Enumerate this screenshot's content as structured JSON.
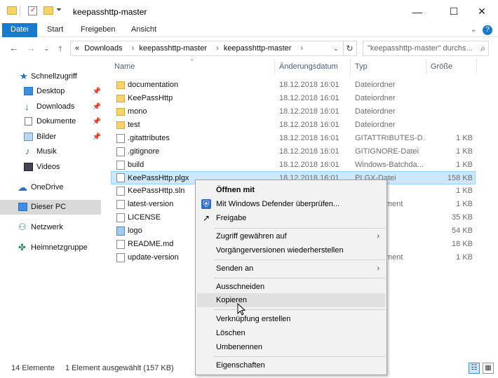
{
  "window": {
    "title": "keepasshttp-master",
    "controls": {
      "minimize": "—",
      "maximize": "☐",
      "close": "✕"
    }
  },
  "ribbon": {
    "tabs": [
      "Datei",
      "Start",
      "Freigeben",
      "Ansicht"
    ],
    "expand": "⌄",
    "help": "?"
  },
  "address": {
    "prefix": "«",
    "crumbs": [
      "Downloads",
      "keepasshttp-master",
      "keepasshttp-master"
    ],
    "separator": "›",
    "dropdown": "⌄",
    "refresh": "↻",
    "search_placeholder": "\"keepasshttp-master\" durchs...",
    "search_icon": "⌕"
  },
  "nav_buttons": {
    "back": "←",
    "forward": "→",
    "recent": "⌄",
    "up": "↑"
  },
  "navpane": {
    "items": [
      {
        "label": "Schnellzugriff",
        "icon": "star-icon",
        "glyph": "★",
        "pinned": false
      },
      {
        "label": "Desktop",
        "icon": "desktop-icon",
        "glyph": "",
        "pinned": true
      },
      {
        "label": "Downloads",
        "icon": "download-icon",
        "glyph": "↓",
        "pinned": true
      },
      {
        "label": "Dokumente",
        "icon": "documents-icon",
        "glyph": "",
        "pinned": true
      },
      {
        "label": "Bilder",
        "icon": "pictures-icon",
        "glyph": "",
        "pinned": true
      },
      {
        "label": "Musik",
        "icon": "music-icon",
        "glyph": "♪",
        "pinned": false
      },
      {
        "label": "Videos",
        "icon": "videos-icon",
        "glyph": "",
        "pinned": false
      },
      {
        "label": "OneDrive",
        "icon": "cloud-icon",
        "glyph": "☁",
        "pinned": false
      },
      {
        "label": "Dieser PC",
        "icon": "pc-icon",
        "glyph": "",
        "pinned": false,
        "selected": true
      },
      {
        "label": "Netzwerk",
        "icon": "network-icon",
        "glyph": "⚇",
        "pinned": false
      },
      {
        "label": "Heimnetzgruppe",
        "icon": "homegroup-icon",
        "glyph": "✤",
        "pinned": false
      }
    ],
    "pin_glyph": "📌"
  },
  "columns": {
    "name": "Name",
    "date": "Änderungsdatum",
    "type": "Typ",
    "size": "Größe"
  },
  "files": [
    {
      "name": "documentation",
      "date": "18.12.2018 16:01",
      "type": "Dateiordner",
      "size": "",
      "kind": "folder"
    },
    {
      "name": "KeePassHttp",
      "date": "18.12.2018 16:01",
      "type": "Dateiordner",
      "size": "",
      "kind": "folder"
    },
    {
      "name": "mono",
      "date": "18.12.2018 16:01",
      "type": "Dateiordner",
      "size": "",
      "kind": "folder"
    },
    {
      "name": "test",
      "date": "18.12.2018 16:01",
      "type": "Dateiordner",
      "size": "",
      "kind": "folder"
    },
    {
      "name": ".gitattributes",
      "date": "18.12.2018 16:01",
      "type": "GITATTRIBUTES-D...",
      "size": "1 KB",
      "kind": "file"
    },
    {
      "name": ".gitignore",
      "date": "18.12.2018 16:01",
      "type": "GITIGNORE-Datei",
      "size": "1 KB",
      "kind": "file"
    },
    {
      "name": "build",
      "date": "18.12.2018 16:01",
      "type": "Windows-Batchda...",
      "size": "1 KB",
      "kind": "file"
    },
    {
      "name": "KeePassHttp.plgx",
      "date": "18.12.2018 16:01",
      "type": "PLGX-Datei",
      "size": "158 KB",
      "kind": "file",
      "selected": true
    },
    {
      "name": "KeePassHttp.sln",
      "date": "",
      "type": "",
      "size": "1 KB",
      "kind": "file"
    },
    {
      "name": "latest-version",
      "date": "",
      "type": "ment",
      "size": "1 KB",
      "kind": "file"
    },
    {
      "name": "LICENSE",
      "date": "",
      "type": "",
      "size": "35 KB",
      "kind": "file"
    },
    {
      "name": "logo",
      "date": "",
      "type": "",
      "size": "54 KB",
      "kind": "image"
    },
    {
      "name": "README.md",
      "date": "",
      "type": "",
      "size": "18 KB",
      "kind": "file"
    },
    {
      "name": "update-version",
      "date": "",
      "type": "ment",
      "size": "1 KB",
      "kind": "file"
    }
  ],
  "status": {
    "count": "14 Elemente",
    "selection": "1 Element ausgewählt (157 KB)",
    "view_details": "☷",
    "view_icons": "▦"
  },
  "context_menu": {
    "open_with": "Öffnen mit",
    "defender": "Mit Windows Defender überprüfen...",
    "share": "Freigabe",
    "grant_access": "Zugriff gewähren auf",
    "restore_versions": "Vorgängerversionen wiederherstellen",
    "send_to": "Senden an",
    "cut": "Ausschneiden",
    "copy": "Kopieren",
    "create_shortcut": "Verknüpfung erstellen",
    "delete": "Löschen",
    "rename": "Umbenennen",
    "properties": "Eigenschaften",
    "submenu_arrow": "›",
    "share_glyph": "↗",
    "shield_glyph": "⛨"
  }
}
